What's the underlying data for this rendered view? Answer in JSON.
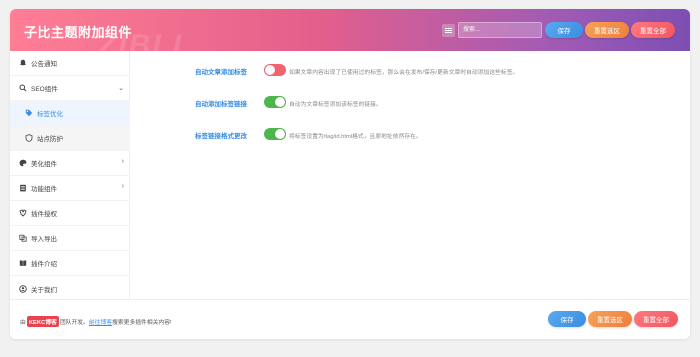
{
  "header": {
    "title": "子比主题附加组件",
    "watermark": "ZIBLL",
    "search_placeholder": "搜索...",
    "save_label": "保存",
    "reset_section_label": "重置选区",
    "reset_all_label": "重置全部"
  },
  "sidebar": {
    "items": [
      {
        "label": "公告通知",
        "icon": "bell-icon"
      },
      {
        "label": "SEO组件",
        "icon": "search-icon"
      },
      {
        "label": "标签优化",
        "icon": "tag-icon"
      },
      {
        "label": "站点防护",
        "icon": "shield-icon"
      },
      {
        "label": "美化组件",
        "icon": "palette-icon"
      },
      {
        "label": "功能组件",
        "icon": "puzzle-icon"
      },
      {
        "label": "插件授权",
        "icon": "key-icon"
      },
      {
        "label": "导入导出",
        "icon": "transfer-icon"
      },
      {
        "label": "插件介绍",
        "icon": "book-icon"
      },
      {
        "label": "关于我们",
        "icon": "user-icon"
      }
    ]
  },
  "settings": [
    {
      "label": "自动文章添加标签",
      "enabled": false,
      "description": "如果文章内容出现了已使用过的标签，那么会在发布/保存/更新文章时自动添加这些标签。"
    },
    {
      "label": "自动添加标签链接",
      "enabled": true,
      "description": "自动为文章标签添加该标签的链接。"
    },
    {
      "label": "标签链接格式更改",
      "enabled": true,
      "description": "将标签设置为/tag/id.html格式，且原地址依然存在。"
    }
  ],
  "footer": {
    "prefix": "由",
    "brand": "KEKC博客",
    "middle": "团队开发。",
    "link_text": "前往博客",
    "suffix": "搜索更多插件相关内容!",
    "save_label": "保存",
    "reset_section_label": "重置选区",
    "reset_all_label": "重置全部"
  },
  "colors": {
    "accent_blue": "#3a8ee0",
    "toggle_on": "#4cb84c",
    "toggle_off": "#f26370",
    "brand_red": "#e8434f"
  }
}
